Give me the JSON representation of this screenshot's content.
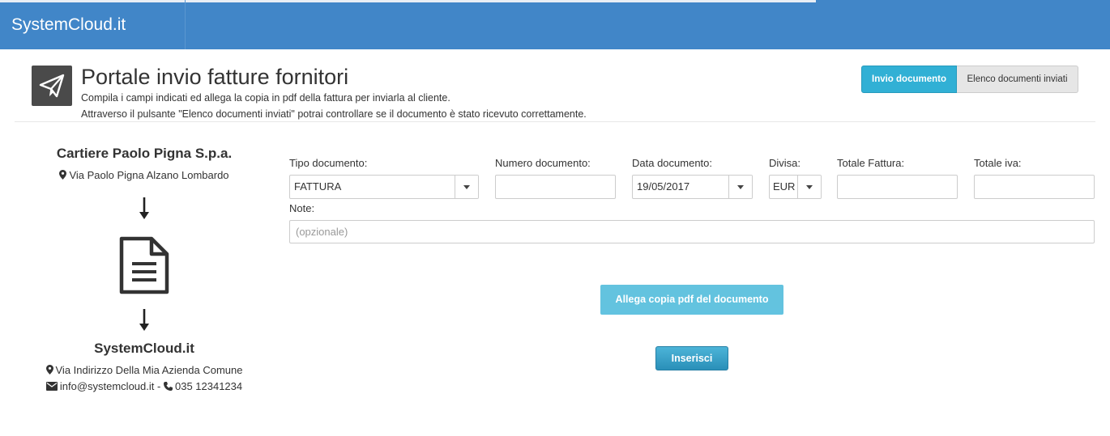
{
  "brand": "SystemCloud.it",
  "header": {
    "title": "Portale invio fatture fornitori",
    "subtitle1": "Compila i campi indicati ed allega la copia in pdf della fattura per inviarla al cliente.",
    "subtitle2": "Attraverso il pulsante \"Elenco documenti inviati\" potrai controllare se il documento è stato ricevuto correttamente.",
    "icon": "paper-plane-icon"
  },
  "tabs": [
    {
      "label": "Invio documento",
      "active": true
    },
    {
      "label": "Elenco documenti inviati",
      "active": false
    }
  ],
  "sender": {
    "name": "Cartiere Paolo Pigna S.p.a.",
    "address": "Via Paolo Pigna Alzano Lombardo"
  },
  "receiver": {
    "name": "SystemCloud.it",
    "address": "Via Indirizzo Della Mia Azienda Comune",
    "email": "info@systemcloud.it",
    "separator": "-",
    "phone": "035 12341234"
  },
  "form": {
    "tipo": {
      "label": "Tipo documento:",
      "value": "FATTURA"
    },
    "numero": {
      "label": "Numero documento:",
      "value": ""
    },
    "data": {
      "label": "Data documento:",
      "value": "19/05/2017"
    },
    "divisa": {
      "label": "Divisa:",
      "value": "EUR"
    },
    "totale": {
      "label": "Totale Fattura:",
      "value": ""
    },
    "iva": {
      "label": "Totale iva:",
      "value": ""
    },
    "note": {
      "label": "Note:",
      "placeholder": "(opzionale)"
    }
  },
  "buttons": {
    "attach": "Allega copia pdf del documento",
    "insert": "Inserisci"
  },
  "colors": {
    "topbar": "#4186c8",
    "accent": "#31b0d5"
  }
}
